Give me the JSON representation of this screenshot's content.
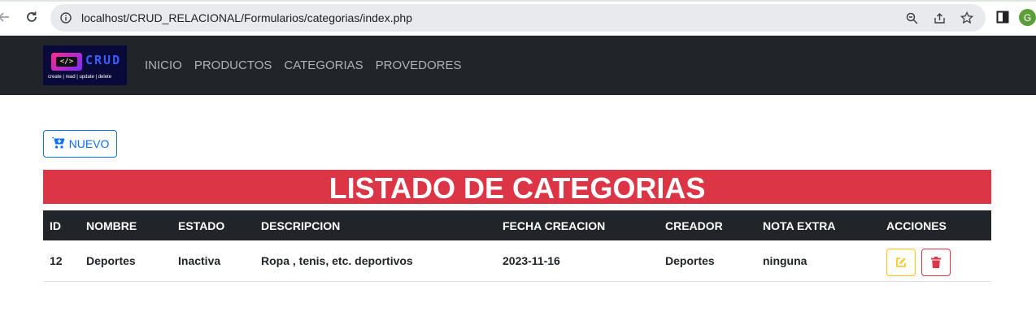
{
  "browser": {
    "url": "localhost/CRUD_RELACIONAL/Formularios/categorias/index.php",
    "profile_initial": "G"
  },
  "logo": {
    "mark": "</>",
    "text": "CRUD",
    "subtitle": "create | read | update | delete"
  },
  "nav": {
    "items": [
      "INICIO",
      "PRODUCTOS",
      "CATEGORIAS",
      "PROVEDORES"
    ]
  },
  "buttons": {
    "nuevo": "NUEVO"
  },
  "page": {
    "title": "LISTADO DE CATEGORIAS"
  },
  "table": {
    "headers": [
      "ID",
      "NOMBRE",
      "ESTADO",
      "DESCRIPCION",
      "FECHA CREACION",
      "CREADOR",
      "NOTA EXTRA",
      "ACCIONES"
    ],
    "rows": [
      {
        "id": "12",
        "nombre": "Deportes",
        "estado": "Inactiva",
        "descripcion": "Ropa , tenis, etc. deportivos",
        "fecha": "2023-11-16",
        "creador": "Deportes",
        "nota": "ninguna"
      }
    ]
  },
  "colors": {
    "primary": "#0d6efd",
    "danger": "#dc3545",
    "warning": "#ffc107",
    "dark": "#212529"
  },
  "icons": [
    "back-arrow-icon",
    "reload-icon",
    "info-icon",
    "zoom-icon",
    "share-icon",
    "star-icon",
    "side-panel-icon",
    "cart-plus-icon",
    "edit-icon",
    "trash-icon"
  ]
}
